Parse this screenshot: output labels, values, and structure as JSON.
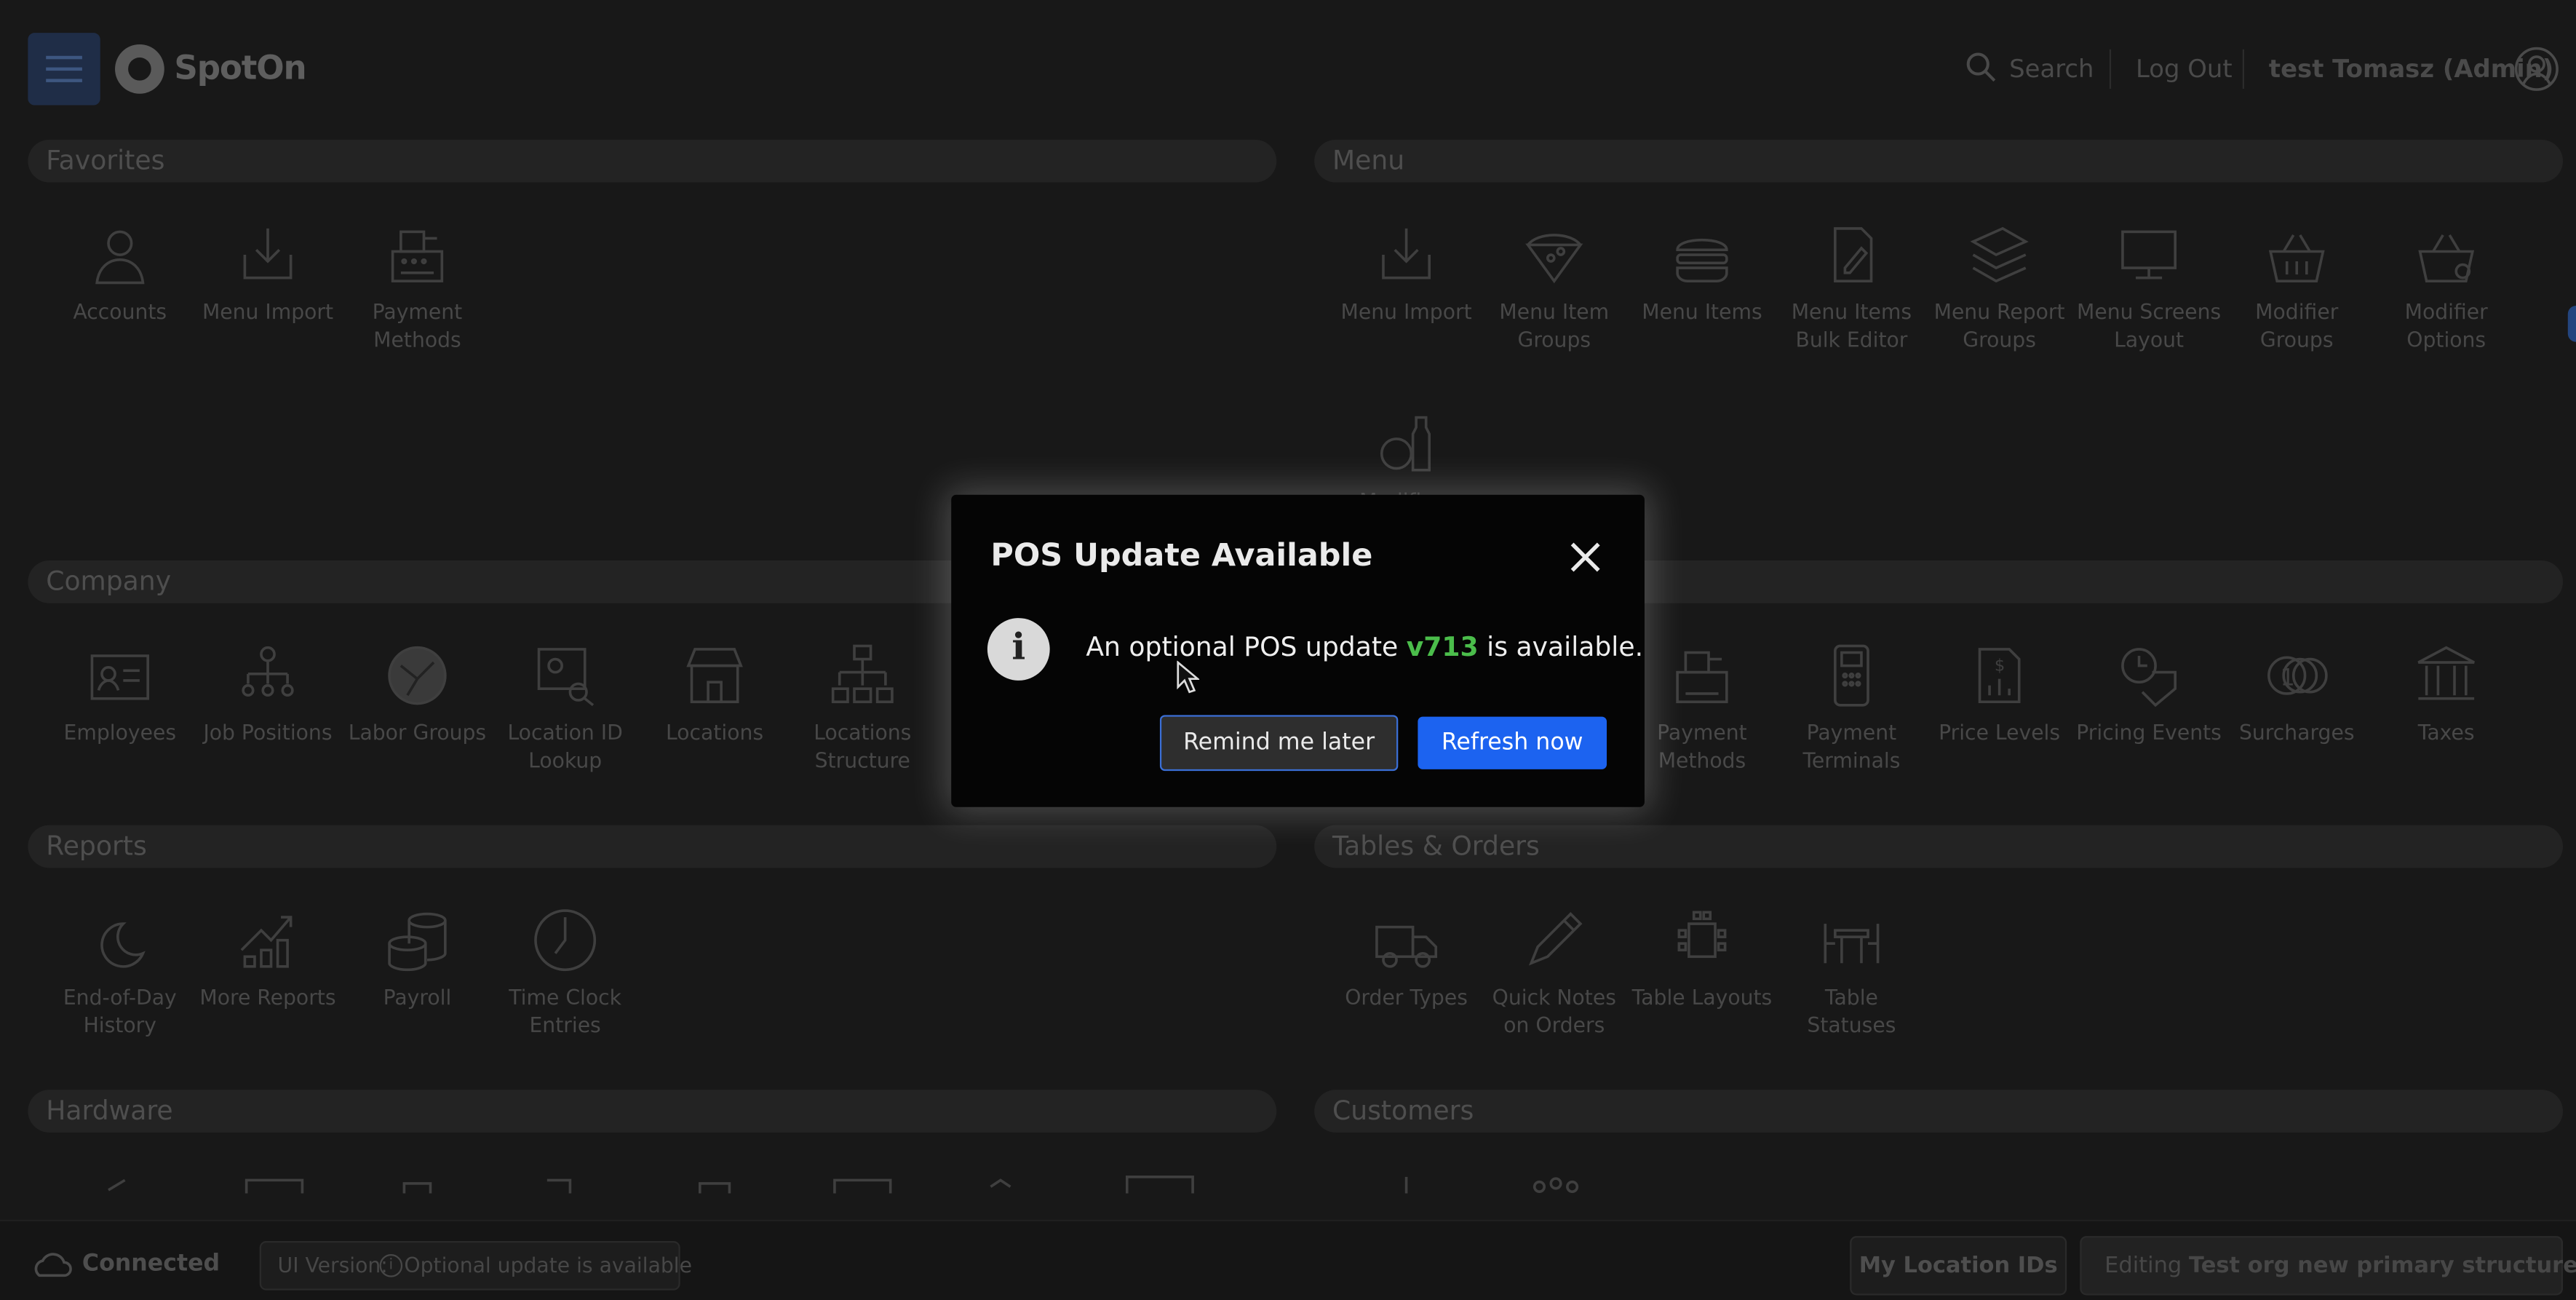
{
  "header": {
    "logo_text": "SpotOn",
    "search_label": "Search",
    "logout_label": "Log Out",
    "user_label": "test Tomasz (Admin)"
  },
  "sections": {
    "favorites": {
      "title": "Favorites",
      "items": [
        "Accounts",
        "Menu Import",
        "Payment Methods"
      ]
    },
    "menu": {
      "title": "Menu",
      "items": [
        "Menu Import",
        "Menu Item Groups",
        "Menu Items",
        "Menu Items Bulk Editor",
        "Menu Report Groups",
        "Menu Screens Layout",
        "Modifier Groups",
        "Modifier Options",
        "Modifiers"
      ]
    },
    "company": {
      "title": "Company",
      "items": [
        "Employees",
        "Job Positions",
        "Labor Groups",
        "Location ID Lookup",
        "Locations",
        "Locations Structure"
      ]
    },
    "company_right": {
      "items": [
        "Payment Methods",
        "Payment Terminals",
        "Price Levels",
        "Pricing Events",
        "Surcharges",
        "Taxes"
      ]
    },
    "reports": {
      "title": "Reports",
      "items": [
        "End-of-Day History",
        "More Reports",
        "Payroll",
        "Time Clock Entries"
      ]
    },
    "tables": {
      "title": "Tables & Orders",
      "items": [
        "Order Types",
        "Quick Notes on Orders",
        "Table Layouts",
        "Table Statuses"
      ]
    },
    "hardware": {
      "title": "Hardware"
    },
    "customers": {
      "title": "Customers"
    }
  },
  "footer": {
    "status": "Connected",
    "ui_version_prefix": "UI Version:",
    "ui_version_text": "Optional update is available",
    "location_ids_button": "My Location IDs",
    "editing_prefix": "Editing",
    "editing_name": "Test org new primary structure"
  },
  "dialog": {
    "title": "POS Update Available",
    "message_before": "An optional POS update",
    "version": "v713",
    "message_after": "is available.",
    "remind_label": "Remind me later",
    "refresh_label": "Refresh now"
  },
  "colors": {
    "primary": "#1c63f0",
    "version": "#4bbd4b",
    "backdrop": "#181818"
  }
}
